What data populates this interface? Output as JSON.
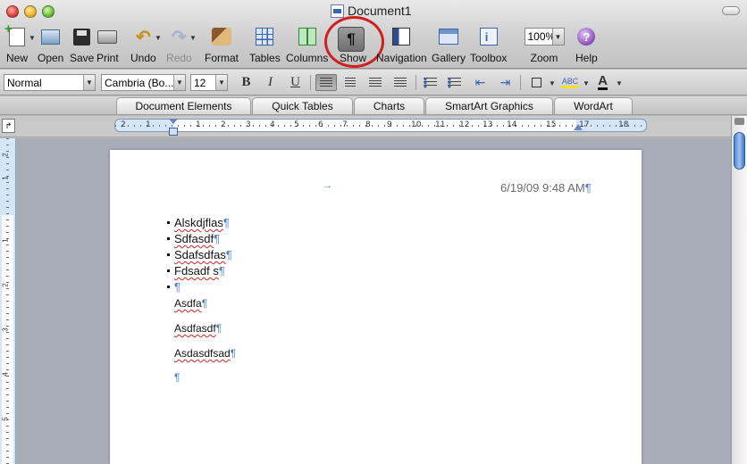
{
  "window": {
    "title": "Document1"
  },
  "toolbar": {
    "items": [
      {
        "label": "New"
      },
      {
        "label": "Open"
      },
      {
        "label": "Save"
      },
      {
        "label": "Print"
      },
      {
        "label": "Undo"
      },
      {
        "label": "Redo"
      },
      {
        "label": "Format"
      },
      {
        "label": "Tables"
      },
      {
        "label": "Columns"
      },
      {
        "label": "Show"
      },
      {
        "label": "Navigation"
      },
      {
        "label": "Gallery"
      },
      {
        "label": "Toolbox"
      },
      {
        "label": "Zoom"
      },
      {
        "label": "Help"
      }
    ],
    "show_symbol": "¶",
    "zoom_value": "100%",
    "highlight_color": "#d01f1f"
  },
  "formatting": {
    "style": "Normal",
    "font": "Cambria (Bo...",
    "size": "12",
    "bold": "B",
    "italic": "I",
    "underline": "U",
    "highlight_sample": "ABC",
    "font_color_sample": "A"
  },
  "gallery_tabs": [
    "Document Elements",
    "Quick Tables",
    "Charts",
    "SmartArt Graphics",
    "WordArt"
  ],
  "ruler": {
    "h_numbers": [
      "2",
      "1",
      "1",
      "2",
      "3",
      "4",
      "5",
      "6",
      "7",
      "8",
      "9",
      "10",
      "11",
      "12",
      "13",
      "14",
      "15",
      "17",
      "18"
    ],
    "v_numbers": [
      "2",
      "1",
      "1",
      "2",
      "3",
      "4",
      "5"
    ]
  },
  "document": {
    "header_date": "6/19/09 9:48 AM",
    "pilcrow": "¶",
    "tab_arrow": "→",
    "bullets": [
      "Alskdjflas",
      "Sdfasdf",
      "Sdafsdfas",
      "Fdsadf s",
      ""
    ],
    "paragraphs": [
      "Asdfa",
      "Asdfasdf",
      "Asdasdfsad",
      ""
    ]
  }
}
